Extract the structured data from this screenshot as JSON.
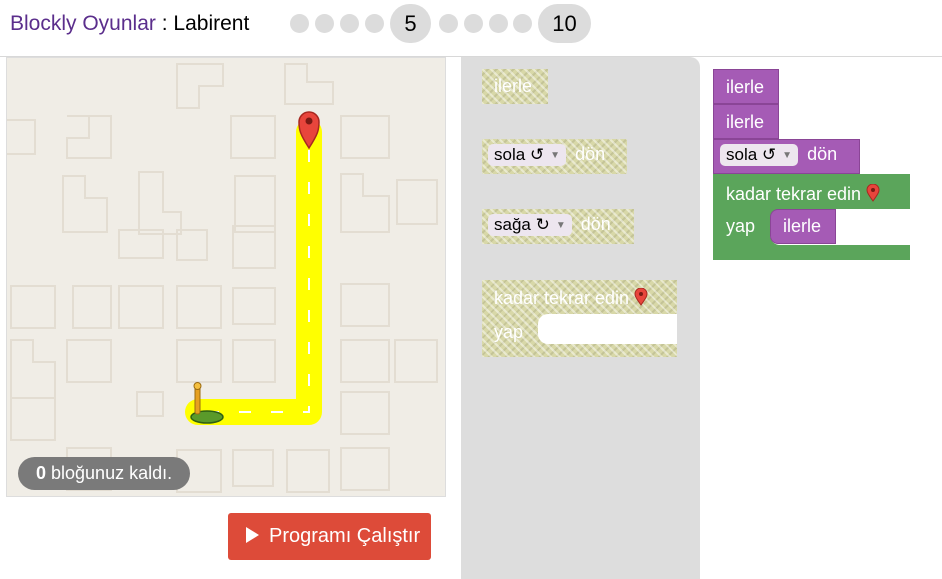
{
  "header": {
    "app_name": "Blockly Oyunlar",
    "separator": " : ",
    "game_name": "Labirent",
    "levels_before": 4,
    "current_level": "5",
    "levels_after": 4,
    "last_level": "10"
  },
  "maze": {
    "remaining_count": "0",
    "remaining_text": " bloğunuz kaldı.",
    "run_button": "Programı Çalıştır"
  },
  "toolbox": {
    "forward": "ilerle",
    "turn_left_dir": "sola ↺",
    "turn_left_verb": "dön",
    "turn_right_dir": "sağa ↻",
    "turn_right_verb": "dön",
    "repeat_label": "kadar tekrar edin",
    "do_label": "yap"
  },
  "workspace": {
    "block1": "ilerle",
    "block2": "ilerle",
    "turn_dir": "sola ↺",
    "turn_verb": "dön",
    "repeat_label": "kadar tekrar edin",
    "do_label": "yap",
    "inner_block": "ilerle"
  },
  "colors": {
    "title_purple": "#5b2e8c",
    "motion_block": "#a55bb5",
    "loop_block": "#5ba55b",
    "run_button": "#dd4b39",
    "path": "#ffff00"
  }
}
